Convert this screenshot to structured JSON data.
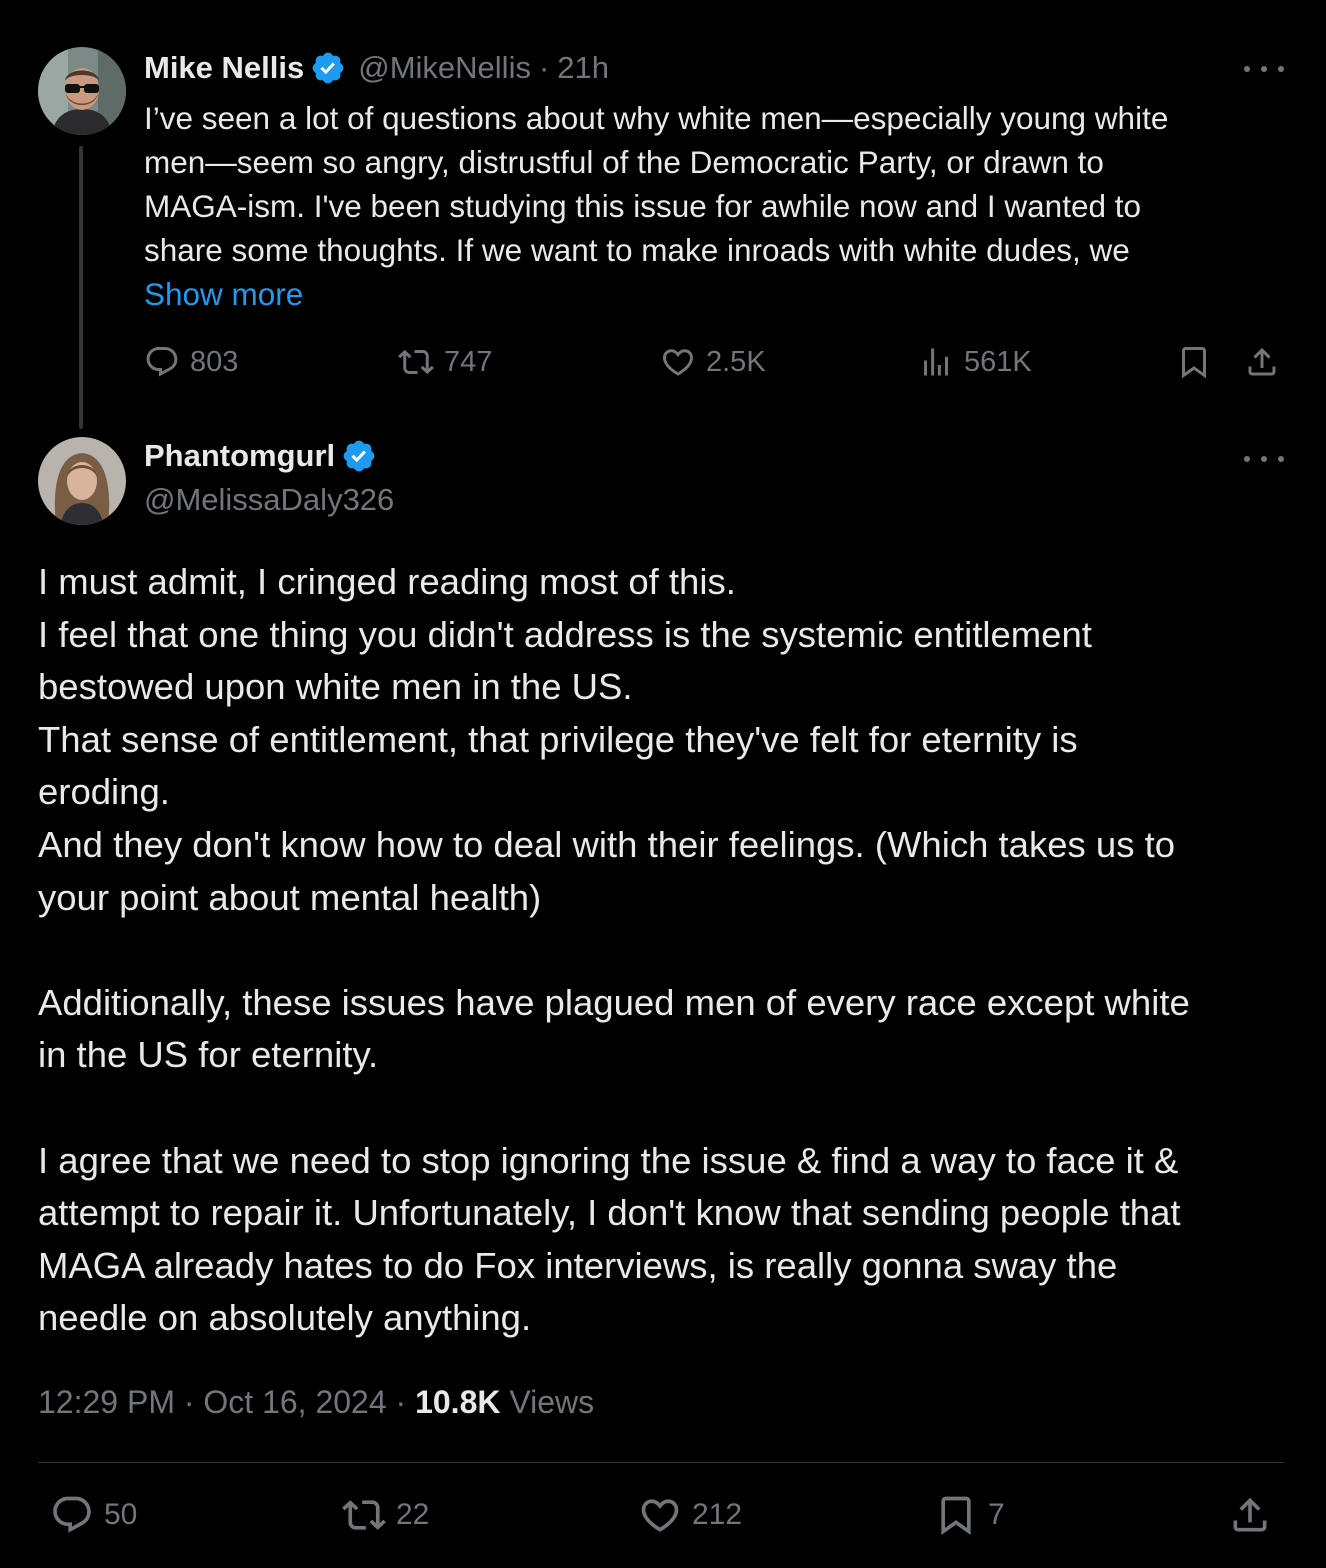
{
  "parent_tweet": {
    "author_name": "Mike Nellis",
    "handle": "@MikeNellis",
    "separator": "·",
    "time_ago": "21h",
    "text_lines": [
      "I’ve seen a lot of questions about why white men—especially young white",
      "men—seem so angry, distrustful of the Democratic Party, or drawn to",
      "MAGA-ism. I've been studying this issue for awhile now and I wanted to",
      "share some thoughts. If we want to make inroads with white dudes, we"
    ],
    "show_more": "Show more",
    "replies": "803",
    "reposts": "747",
    "likes": "2.5K",
    "views": "561K"
  },
  "reply_tweet": {
    "author_name": "Phantomgurl",
    "handle": "@MelissaDaly326",
    "paragraphs": [
      "I must admit, I cringed reading most of this.",
      "I feel that one thing you didn't address is the systemic entitlement",
      "bestowed upon white men in the US.",
      "That sense of entitlement, that privilege they've felt for eternity is",
      "eroding.",
      "And they don't know how to deal with their feelings. (Which takes us to",
      "your point about mental health)",
      "",
      "Additionally, these issues have plagued men of every race except white",
      "in the US for eternity.",
      "",
      "I agree that we need to stop ignoring the issue & find a way to face it &",
      "attempt to repair it. Unfortunately, I don't know that sending people that",
      "MAGA already hates to do Fox interviews, is really gonna sway the",
      "needle on absolutely anything."
    ],
    "time": "12:29 PM",
    "date": "Oct 16, 2024",
    "separator": "·",
    "views_count": "10.8K",
    "views_label": "Views",
    "replies": "50",
    "reposts": "22",
    "likes": "212",
    "bookmarks": "7"
  },
  "colors": {
    "background": "#000000",
    "text": "#e7e9ea",
    "muted": "#71767b",
    "link": "#1d9bf0",
    "verified": "#1d9bf0",
    "divider": "#2f3336"
  },
  "icons": [
    "verified-badge-icon",
    "more-icon",
    "reply-icon",
    "repost-icon",
    "like-icon",
    "views-icon",
    "bookmark-icon",
    "share-icon"
  ]
}
